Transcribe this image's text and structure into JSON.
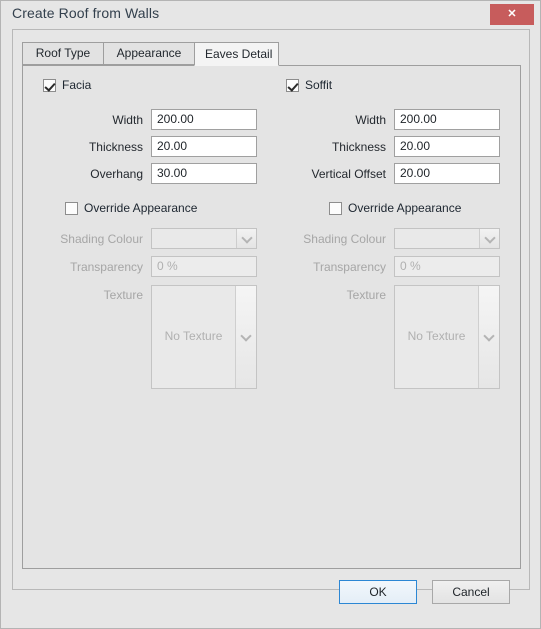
{
  "window": {
    "title": "Create Roof from Walls",
    "close_label": "✕",
    "close_icon": "close-icon",
    "close_color": "#c75c5c"
  },
  "tabs": [
    {
      "label": "Roof Type",
      "active": false
    },
    {
      "label": "Appearance",
      "active": false
    },
    {
      "label": "Eaves Detail",
      "active": true
    }
  ],
  "panes": {
    "facia": {
      "enabled_label": "Facia",
      "enabled": true,
      "fields": [
        {
          "label": "Width",
          "value": "200.00"
        },
        {
          "label": "Thickness",
          "value": "20.00"
        },
        {
          "label": "Overhang",
          "value": "30.00"
        }
      ],
      "override": {
        "label": "Override Appearance",
        "checked": false
      },
      "shading_colour": {
        "label": "Shading Colour",
        "value": "",
        "disabled": true,
        "arrow_icon": "chevron-down-icon"
      },
      "transparency": {
        "label": "Transparency",
        "value": "0 %",
        "disabled": true
      },
      "texture": {
        "label": "Texture",
        "value": "No Texture",
        "disabled": true,
        "arrow_icon": "chevron-down-icon"
      }
    },
    "soffit": {
      "enabled_label": "Soffit",
      "enabled": true,
      "fields": [
        {
          "label": "Width",
          "value": "200.00"
        },
        {
          "label": "Thickness",
          "value": "20.00"
        },
        {
          "label": "Vertical Offset",
          "value": "20.00"
        }
      ],
      "override": {
        "label": "Override Appearance",
        "checked": false
      },
      "shading_colour": {
        "label": "Shading Colour",
        "value": "",
        "disabled": true,
        "arrow_icon": "chevron-down-icon"
      },
      "transparency": {
        "label": "Transparency",
        "value": "0 %",
        "disabled": true
      },
      "texture": {
        "label": "Texture",
        "value": "No Texture",
        "disabled": true,
        "arrow_icon": "chevron-down-icon"
      }
    }
  },
  "footer": {
    "ok_label": "OK",
    "cancel_label": "Cancel",
    "default_button": "OK",
    "focus_color": "#2c87d4"
  }
}
